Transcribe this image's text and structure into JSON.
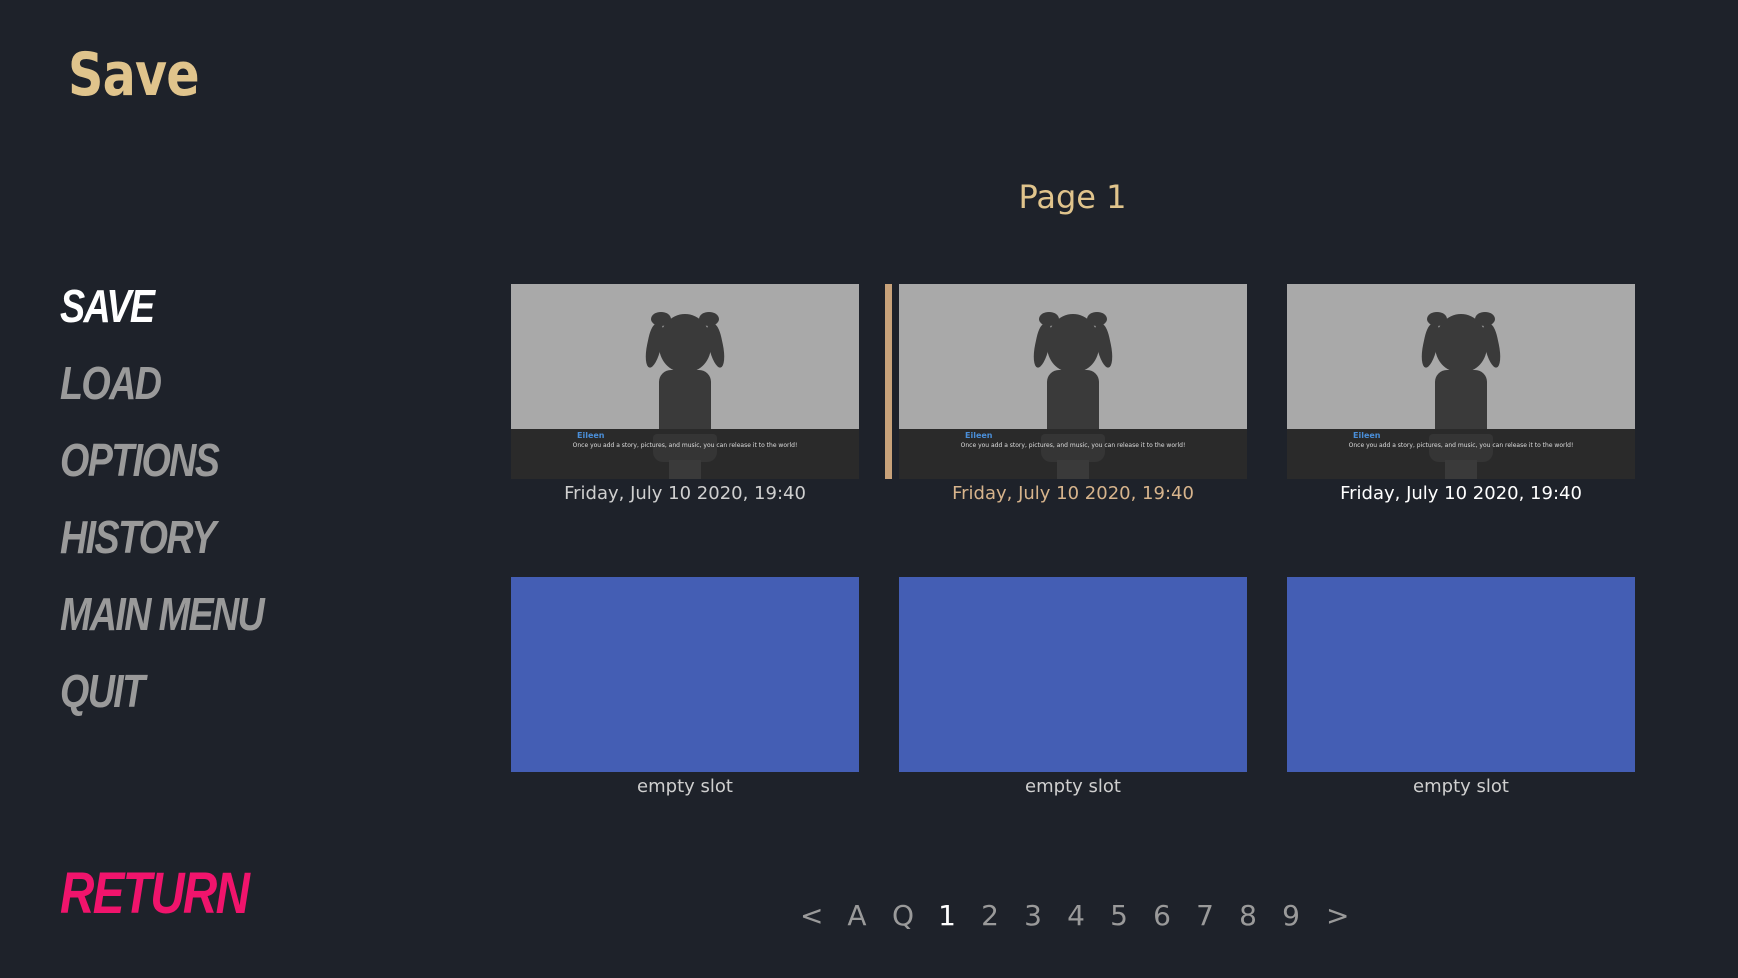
{
  "screen": {
    "title": "Save",
    "page_title": "Page 1"
  },
  "nav": {
    "items": [
      {
        "label": "Save",
        "active": true
      },
      {
        "label": "Load",
        "active": false
      },
      {
        "label": "Options",
        "active": false
      },
      {
        "label": "History",
        "active": false
      },
      {
        "label": "Main Menu",
        "active": false
      },
      {
        "label": "Quit",
        "active": false
      }
    ],
    "return_label": "Return"
  },
  "slots": [
    {
      "state": "filled",
      "label": "Friday, July 10 2020, 19:40",
      "speaker": "Eileen",
      "dialog": "Once you add a story, pictures, and music, you can release it to the world!"
    },
    {
      "state": "filled",
      "label": "Friday, July 10 2020, 19:40",
      "speaker": "Eileen",
      "dialog": "Once you add a story, pictures, and music, you can release it to the world!",
      "selected": true
    },
    {
      "state": "filled",
      "label": "Friday, July 10 2020, 19:40",
      "speaker": "Eileen",
      "dialog": "Once you add a story, pictures, and music, you can release it to the world!"
    },
    {
      "state": "empty",
      "label": "empty slot"
    },
    {
      "state": "empty",
      "label": "empty slot"
    },
    {
      "state": "empty",
      "label": "empty slot"
    }
  ],
  "pager": {
    "prev": "<",
    "auto": "A",
    "quick": "Q",
    "pages": [
      "1",
      "2",
      "3",
      "4",
      "5",
      "6",
      "7",
      "8",
      "9"
    ],
    "current": "1",
    "next": ">"
  },
  "colors": {
    "background": "#1e222a",
    "accent_gold": "#e0c48c",
    "return_pink": "#f0146c",
    "empty_slot_blue": "#445eb4",
    "selected_bar": "#c8a27a"
  }
}
